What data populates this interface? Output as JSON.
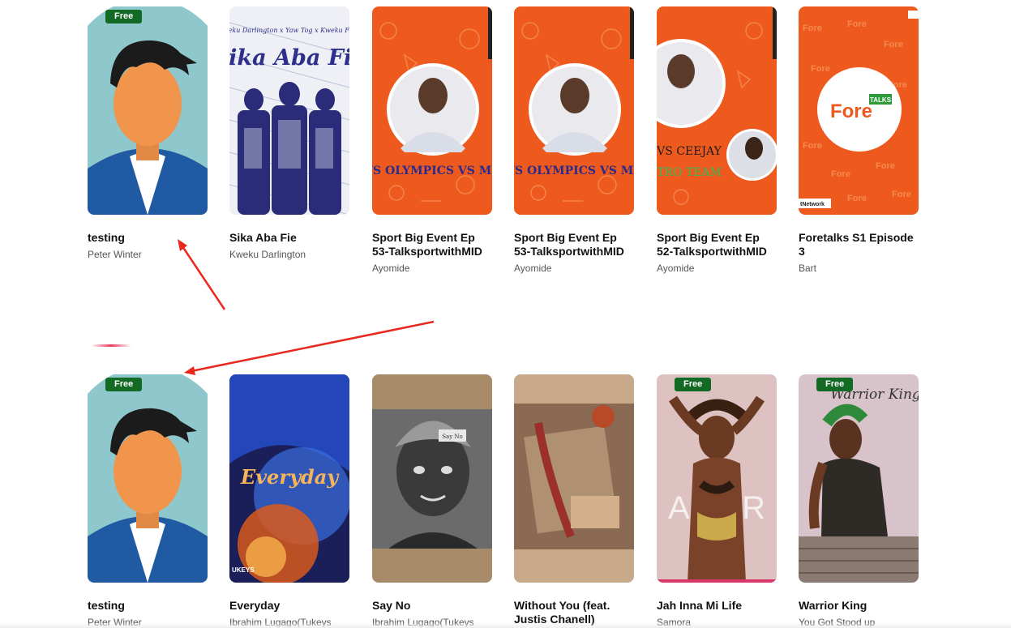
{
  "row1": [
    {
      "title": "testing",
      "artist": "Peter Winter",
      "badge": "Free",
      "cover_icon": "default-avatar-cover"
    },
    {
      "title": "Sika Aba Fie",
      "artist": "Kweku Darlington",
      "cover_text": "Sika Aba Fie",
      "cover_credits": "Kweku Darlington x Yaw Tog x Kweku Flick",
      "cover_icon": "album-art-cover"
    },
    {
      "title": "Sport Big Event Ep 53-TalksportwithMID",
      "artist": "Ayomide",
      "cover_text": "VS OLYMPICS VS ME",
      "cover_icon": "podcast-art-cover"
    },
    {
      "title": "Sport Big Event Ep 53-TalksportwithMID",
      "artist": "Ayomide",
      "cover_text": "VS OLYMPICS VS ME",
      "cover_icon": "podcast-art-cover"
    },
    {
      "title": "Sport Big Event Ep 52-TalksportwithMID",
      "artist": "Ayomide",
      "cover_text": "VS CEEJAY",
      "cover_sub": "TRO TEAM",
      "cover_icon": "podcast-art-cover"
    },
    {
      "title": "Foretalks S1 Episode 3",
      "artist": "Bart",
      "cover_text": "Fore",
      "cover_tag": "TALKS",
      "cover_corner": "tNetwork",
      "cover_icon": "foretalks-logo-cover"
    }
  ],
  "row2": [
    {
      "title": "testing",
      "artist": "Peter Winter",
      "badge": "Free",
      "cover_icon": "default-avatar-cover"
    },
    {
      "title": "Everyday",
      "artist": "Ibrahim Lugago(Tukeys",
      "cover_text": "Everyday",
      "cover_corner": "UKEYS",
      "cover_icon": "album-art-cover"
    },
    {
      "title": "Say No",
      "artist": "Ibrahim Lugago(Tukeys",
      "cover_text": "Say No",
      "cover_icon": "album-art-cover"
    },
    {
      "title": "Without You (feat. Justis Chanell)",
      "artist": "",
      "cover_icon": "album-art-cover"
    },
    {
      "title": "Jah Inna Mi Life",
      "artist": "Samora",
      "badge": "Free",
      "cover_text": "AMOR",
      "cover_icon": "album-art-cover"
    },
    {
      "title": "Warrior King",
      "artist": "You Got Stood up",
      "badge": "Free",
      "cover_text": "Warrior King",
      "cover_icon": "album-art-cover"
    }
  ],
  "colors": {
    "badge": "#136a24",
    "annotation_arrow": "#e8281e",
    "podcast_orange": "#ee5a1e",
    "avatar_bg": "#8ec8cc",
    "avatar_shirt": "#1f5aa3"
  }
}
